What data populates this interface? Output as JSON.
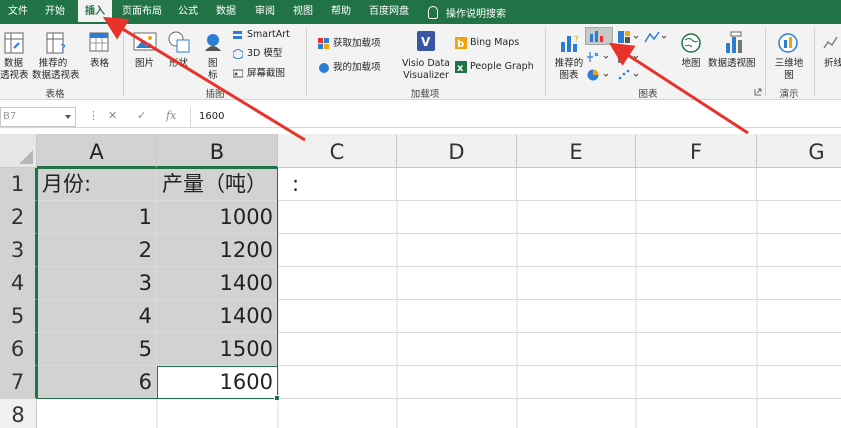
{
  "tabs": [
    {
      "id": "file",
      "label": "文件"
    },
    {
      "id": "home",
      "label": "开始"
    },
    {
      "id": "insert",
      "label": "插入"
    },
    {
      "id": "pagelayout",
      "label": "页面布局"
    },
    {
      "id": "formulas",
      "label": "公式"
    },
    {
      "id": "data",
      "label": "数据"
    },
    {
      "id": "review",
      "label": "审阅"
    },
    {
      "id": "view",
      "label": "视图"
    },
    {
      "id": "help",
      "label": "帮助"
    },
    {
      "id": "baidu",
      "label": "百度网盘"
    }
  ],
  "active_tab": "插入",
  "tell_me": "操作说明搜索",
  "ribbon": {
    "tables": {
      "pivot_line1": "数据",
      "pivot_line2": "透视表",
      "rec_pivot_line1": "推荐的",
      "rec_pivot_line2": "数据透视表",
      "table": "表格",
      "group": "表格"
    },
    "illustrations": {
      "pictures": "图片",
      "shapes": "形状",
      "icons_line1": "图",
      "icons_line2": "标",
      "smartart": "SmartArt",
      "model3d": "3D 模型",
      "screenshot": "屏幕截图",
      "group": "插图"
    },
    "addins": {
      "get": "获取加载项",
      "my": "我的加载项",
      "visio_line1": "Visio Data",
      "visio_line2": "Visualizer",
      "bing": "Bing Maps",
      "people": "People Graph",
      "group": "加载项"
    },
    "charts": {
      "rec_line1": "推荐的",
      "rec_line2": "图表",
      "maps": "地图",
      "pivotchart": "数据透视图",
      "group": "图表"
    },
    "tours": {
      "map3d_line1": "三维地",
      "map3d_line2": "图",
      "group": "演示"
    },
    "sparklines": {
      "line": "折线"
    }
  },
  "formula_bar": {
    "name_box": "B7",
    "cancel": "✕",
    "enter": "✓",
    "fx": "fx",
    "value": "1600"
  },
  "sheet": {
    "columns": [
      "A",
      "B",
      "C",
      "D",
      "E",
      "F",
      "G"
    ],
    "rows": [
      "1",
      "2",
      "3",
      "4",
      "5",
      "6",
      "7",
      "8"
    ],
    "cells": {
      "A1": "月份:",
      "B1": "产量（吨）",
      "C1": ":",
      "A2": "1",
      "B2": "1000",
      "A3": "2",
      "B3": "1200",
      "A4": "3",
      "B4": "1400",
      "A5": "4",
      "B5": "1400",
      "A6": "5",
      "B6": "1500",
      "A7": "6",
      "B7": "1600"
    }
  },
  "colors": {
    "excel_green": "#217346",
    "arrow_red": "#e8322a"
  }
}
